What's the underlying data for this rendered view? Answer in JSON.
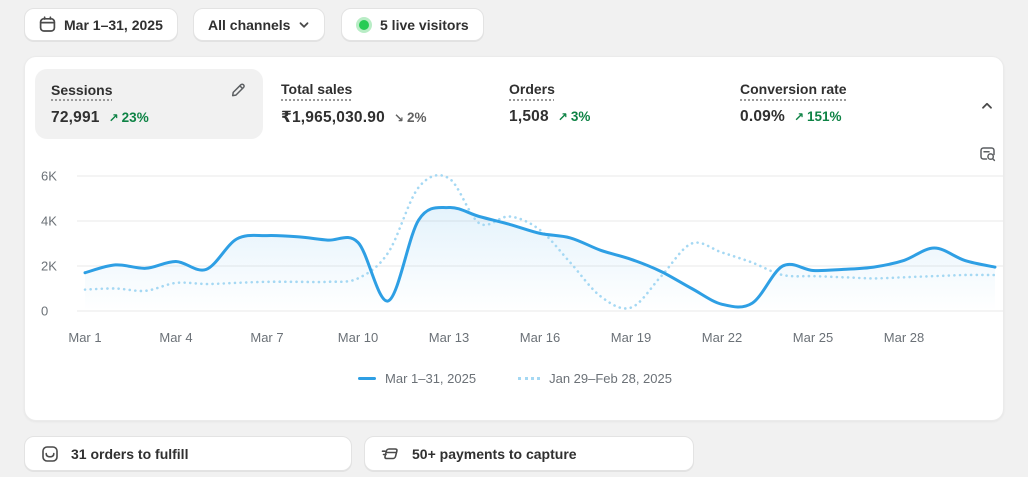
{
  "topbar": {
    "date_range": "Mar 1–31, 2025",
    "date_icon": "calendar-icon",
    "channels": "All channels",
    "channels_icon": "chevron-down-icon",
    "live_visitors": "5 live visitors",
    "live_icon": "live-status-dot"
  },
  "metrics": [
    {
      "label": "Sessions",
      "value": "72,991",
      "delta": "23%",
      "direction": "up",
      "selected": true,
      "edit_icon": "pencil-icon"
    },
    {
      "label": "Total sales",
      "value": "₹1,965,030.90",
      "delta": "2%",
      "direction": "down",
      "selected": false
    },
    {
      "label": "Orders",
      "value": "1,508",
      "delta": "3%",
      "direction": "up",
      "selected": false
    },
    {
      "label": "Conversion rate",
      "value": "0.09%",
      "delta": "151%",
      "direction": "up",
      "selected": false
    }
  ],
  "card_controls": {
    "collapse_icon": "chevron-up-icon",
    "inspect_icon": "inspect-chart-icon"
  },
  "chart_data": {
    "type": "line",
    "title": "Sessions",
    "xlabel": "",
    "ylabel": "Sessions",
    "ylim": [
      0,
      6000
    ],
    "grid": true,
    "legend_position": "bottom",
    "x": [
      "Mar 1",
      "Mar 2",
      "Mar 3",
      "Mar 4",
      "Mar 5",
      "Mar 6",
      "Mar 7",
      "Mar 8",
      "Mar 9",
      "Mar 10",
      "Mar 11",
      "Mar 12",
      "Mar 13",
      "Mar 14",
      "Mar 15",
      "Mar 16",
      "Mar 17",
      "Mar 18",
      "Mar 19",
      "Mar 20",
      "Mar 21",
      "Mar 22",
      "Mar 23",
      "Mar 24",
      "Mar 25",
      "Mar 26",
      "Mar 27",
      "Mar 28",
      "Mar 29",
      "Mar 30",
      "Mar 31"
    ],
    "xticks": [
      "Mar 1",
      "Mar 4",
      "Mar 7",
      "Mar 10",
      "Mar 13",
      "Mar 16",
      "Mar 19",
      "Mar 22",
      "Mar 25",
      "Mar 28"
    ],
    "xtick_indices": [
      0,
      3,
      6,
      9,
      12,
      15,
      18,
      21,
      24,
      27
    ],
    "yticks": [
      {
        "label": "0",
        "value": 0
      },
      {
        "label": "2K",
        "value": 2000
      },
      {
        "label": "4K",
        "value": 4000
      },
      {
        "label": "6K",
        "value": 6000
      }
    ],
    "series": [
      {
        "name": "Mar 1–31, 2025",
        "style": "solid",
        "color": "#2e9fe4",
        "fill": "rgba(46,159,228,0.13)",
        "values": [
          1700,
          2050,
          1900,
          2200,
          1850,
          3200,
          3350,
          3300,
          3150,
          3050,
          450,
          4050,
          4600,
          4200,
          3850,
          3450,
          3250,
          2700,
          2300,
          1750,
          1000,
          300,
          350,
          2000,
          1800,
          1850,
          1950,
          2250,
          2800,
          2250,
          1950
        ]
      },
      {
        "name": "Jan 29–Feb 28, 2025",
        "style": "dotted",
        "color": "#a5d8f3",
        "fill": "none",
        "values": [
          950,
          1000,
          900,
          1250,
          1200,
          1250,
          1300,
          1300,
          1300,
          1450,
          2600,
          5500,
          5900,
          3900,
          4200,
          3600,
          2150,
          650,
          150,
          1550,
          3000,
          2600,
          2150,
          1600,
          1550,
          1500,
          1450,
          1500,
          1550,
          1600,
          1600
        ]
      }
    ]
  },
  "footer_actions": [
    {
      "label": "31 orders to fulfill",
      "icon": "orders-inbox-icon"
    },
    {
      "label": "50+ payments to capture",
      "icon": "payments-card-icon"
    }
  ],
  "colors": {
    "positive": "#0e8345",
    "neutral": "#616161",
    "live_dot": "#27cb54",
    "live_halo": "#b9edc6",
    "gridline": "#e9e9e9",
    "axis_text": "#6b7177"
  }
}
